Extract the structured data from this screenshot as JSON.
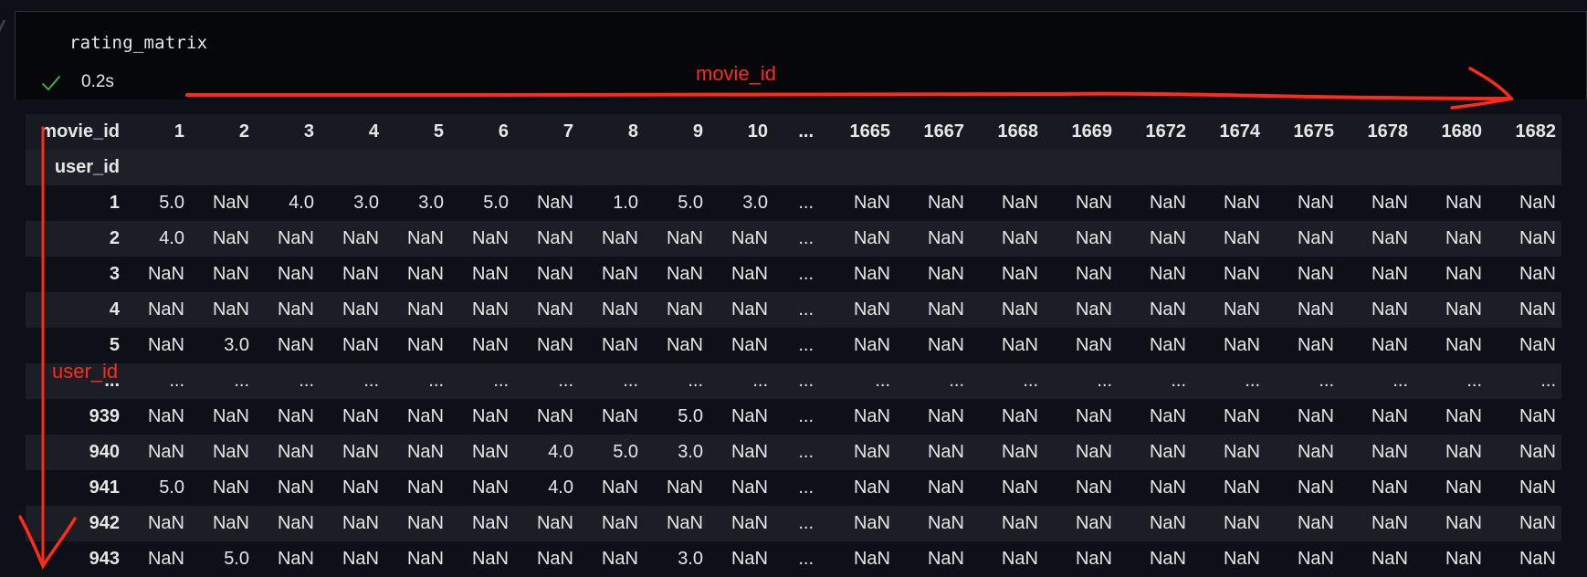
{
  "cell": {
    "code": "rating_matrix",
    "status_icon": "check-icon",
    "exec_time": "0.2s"
  },
  "annotations": {
    "horizontal_label": "movie_id",
    "vertical_label": "user_id",
    "color": "#ff2a1a"
  },
  "dataframe": {
    "columns_name": "movie_id",
    "index_name": "user_id",
    "columns": [
      "1",
      "2",
      "3",
      "4",
      "5",
      "6",
      "7",
      "8",
      "9",
      "10",
      "...",
      "1665",
      "1667",
      "1668",
      "1669",
      "1672",
      "1674",
      "1675",
      "1678",
      "1680",
      "1682"
    ],
    "rows": [
      {
        "index": "1",
        "values": [
          "5.0",
          "NaN",
          "4.0",
          "3.0",
          "3.0",
          "5.0",
          "NaN",
          "1.0",
          "5.0",
          "3.0",
          "...",
          "NaN",
          "NaN",
          "NaN",
          "NaN",
          "NaN",
          "NaN",
          "NaN",
          "NaN",
          "NaN",
          "NaN"
        ]
      },
      {
        "index": "2",
        "values": [
          "4.0",
          "NaN",
          "NaN",
          "NaN",
          "NaN",
          "NaN",
          "NaN",
          "NaN",
          "NaN",
          "NaN",
          "...",
          "NaN",
          "NaN",
          "NaN",
          "NaN",
          "NaN",
          "NaN",
          "NaN",
          "NaN",
          "NaN",
          "NaN"
        ]
      },
      {
        "index": "3",
        "values": [
          "NaN",
          "NaN",
          "NaN",
          "NaN",
          "NaN",
          "NaN",
          "NaN",
          "NaN",
          "NaN",
          "NaN",
          "...",
          "NaN",
          "NaN",
          "NaN",
          "NaN",
          "NaN",
          "NaN",
          "NaN",
          "NaN",
          "NaN",
          "NaN"
        ]
      },
      {
        "index": "4",
        "values": [
          "NaN",
          "NaN",
          "NaN",
          "NaN",
          "NaN",
          "NaN",
          "NaN",
          "NaN",
          "NaN",
          "NaN",
          "...",
          "NaN",
          "NaN",
          "NaN",
          "NaN",
          "NaN",
          "NaN",
          "NaN",
          "NaN",
          "NaN",
          "NaN"
        ]
      },
      {
        "index": "5",
        "values": [
          "NaN",
          "3.0",
          "NaN",
          "NaN",
          "NaN",
          "NaN",
          "NaN",
          "NaN",
          "NaN",
          "NaN",
          "...",
          "NaN",
          "NaN",
          "NaN",
          "NaN",
          "NaN",
          "NaN",
          "NaN",
          "NaN",
          "NaN",
          "NaN"
        ]
      },
      {
        "index": "...",
        "values": [
          "...",
          "...",
          "...",
          "...",
          "...",
          "...",
          "...",
          "...",
          "...",
          "...",
          "...",
          "...",
          "...",
          "...",
          "...",
          "...",
          "...",
          "...",
          "...",
          "...",
          "..."
        ]
      },
      {
        "index": "939",
        "values": [
          "NaN",
          "NaN",
          "NaN",
          "NaN",
          "NaN",
          "NaN",
          "NaN",
          "NaN",
          "5.0",
          "NaN",
          "...",
          "NaN",
          "NaN",
          "NaN",
          "NaN",
          "NaN",
          "NaN",
          "NaN",
          "NaN",
          "NaN",
          "NaN"
        ]
      },
      {
        "index": "940",
        "values": [
          "NaN",
          "NaN",
          "NaN",
          "NaN",
          "NaN",
          "NaN",
          "4.0",
          "5.0",
          "3.0",
          "NaN",
          "...",
          "NaN",
          "NaN",
          "NaN",
          "NaN",
          "NaN",
          "NaN",
          "NaN",
          "NaN",
          "NaN",
          "NaN"
        ]
      },
      {
        "index": "941",
        "values": [
          "5.0",
          "NaN",
          "NaN",
          "NaN",
          "NaN",
          "NaN",
          "4.0",
          "NaN",
          "NaN",
          "NaN",
          "...",
          "NaN",
          "NaN",
          "NaN",
          "NaN",
          "NaN",
          "NaN",
          "NaN",
          "NaN",
          "NaN",
          "NaN"
        ]
      },
      {
        "index": "942",
        "values": [
          "NaN",
          "NaN",
          "NaN",
          "NaN",
          "NaN",
          "NaN",
          "NaN",
          "NaN",
          "NaN",
          "NaN",
          "...",
          "NaN",
          "NaN",
          "NaN",
          "NaN",
          "NaN",
          "NaN",
          "NaN",
          "NaN",
          "NaN",
          "NaN"
        ]
      },
      {
        "index": "943",
        "values": [
          "NaN",
          "5.0",
          "NaN",
          "NaN",
          "NaN",
          "NaN",
          "NaN",
          "NaN",
          "3.0",
          "NaN",
          "...",
          "NaN",
          "NaN",
          "NaN",
          "NaN",
          "NaN",
          "NaN",
          "NaN",
          "NaN",
          "NaN",
          "NaN"
        ]
      }
    ]
  }
}
